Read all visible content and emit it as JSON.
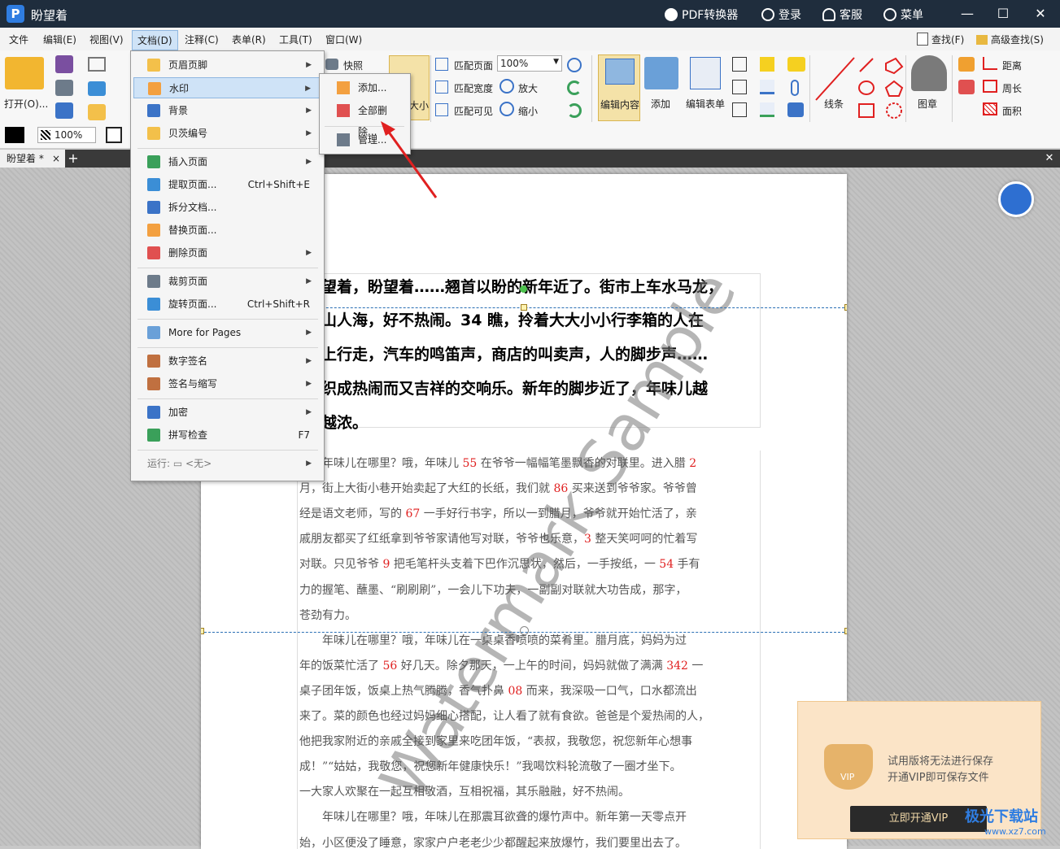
{
  "titlebar": {
    "logo_letter": "P",
    "app_name": "盼望着",
    "pdf_converter": "PDF转换器",
    "login": "登录",
    "service": "客服",
    "menu": "菜单",
    "minimize": "—",
    "maximize": "☐",
    "close": "✕"
  },
  "menubar": {
    "items": [
      "文件",
      "编辑(E)",
      "视图(V)",
      "文档(D)",
      "注释(C)",
      "表单(R)",
      "工具(T)",
      "窗口(W)"
    ],
    "find": "查找(F)",
    "advanced_find": "高级查找(S)"
  },
  "ribbon": {
    "open": "打开(O)...",
    "snapshot": "快照",
    "size_partial": "大小",
    "fit_page": "匹配页面",
    "fit_width": "匹配宽度",
    "fit_visible": "匹配可见",
    "zoom_value": "100%",
    "zoom_in": "放大",
    "zoom_out": "缩小",
    "edit_content": "编辑内容",
    "add": "添加",
    "edit_form": "编辑表单",
    "lines": "线条",
    "stamp": "图章",
    "distance": "距离",
    "perimeter": "周长",
    "area": "面积",
    "opacity_value": "100%"
  },
  "tabs": {
    "doc_tab": "盼望着 *",
    "close_tab": "×",
    "add_tab": "+",
    "close_all": "✕"
  },
  "doc_menu": {
    "items": [
      {
        "label": "页眉页脚",
        "shortcut": "",
        "arrow": "▶"
      },
      {
        "label": "水印",
        "shortcut": "",
        "arrow": "▶"
      },
      {
        "label": "背景",
        "shortcut": "",
        "arrow": "▶"
      },
      {
        "label": "贝茨编号",
        "shortcut": "",
        "arrow": "▶"
      },
      {
        "label": "插入页面",
        "shortcut": "",
        "arrow": "▶"
      },
      {
        "label": "提取页面...",
        "shortcut": "Ctrl+Shift+E",
        "arrow": ""
      },
      {
        "label": "拆分文档...",
        "shortcut": "",
        "arrow": ""
      },
      {
        "label": "替换页面...",
        "shortcut": "",
        "arrow": ""
      },
      {
        "label": "删除页面",
        "shortcut": "",
        "arrow": "▶"
      },
      {
        "label": "裁剪页面",
        "shortcut": "",
        "arrow": "▶"
      },
      {
        "label": "旋转页面...",
        "shortcut": "Ctrl+Shift+R",
        "arrow": ""
      },
      {
        "label": "More for Pages",
        "shortcut": "",
        "arrow": "▶"
      },
      {
        "label": "数字签名",
        "shortcut": "",
        "arrow": "▶"
      },
      {
        "label": "签名与缩写",
        "shortcut": "",
        "arrow": "▶"
      },
      {
        "label": "加密",
        "shortcut": "",
        "arrow": "▶"
      },
      {
        "label": "拼写检查",
        "shortcut": "F7",
        "arrow": ""
      },
      {
        "label": "运行: ▭ <无>",
        "shortcut": "",
        "arrow": "▶"
      }
    ]
  },
  "watermark_submenu": {
    "add": "添加...",
    "delete_all": "全部删除...",
    "manage": "管理..."
  },
  "document": {
    "heading_lines": [
      "望着，盼望着……翘首以盼的新年近了。街市上车水马龙，",
      "山人海，好不热闹。34 瞧，拎着大大小小行李箱的人在",
      "上行走，汽车的鸣笛声，商店的叫卖声，人的脚步声……",
      "织成热闹而又吉祥的交响乐。新年的脚步近了，年味儿越",
      "越浓。"
    ],
    "body_lines": [
      [
        {
          "t": "　　年味儿在哪里？哦，年味儿 "
        },
        {
          "t": "55",
          "r": true
        },
        {
          "t": " 在爷爷一幅幅笔墨飘香的对联里。进入腊 "
        },
        {
          "t": "2",
          "r": true
        }
      ],
      [
        {
          "t": "月，街上大街小巷开始卖起了大红的长纸，我们就 "
        },
        {
          "t": "86",
          "r": true
        },
        {
          "t": " 买来送到爷爷家。爷爷曾"
        }
      ],
      [
        {
          "t": "经是语文老师，写的 "
        },
        {
          "t": "67",
          "r": true
        },
        {
          "t": " 一手好行书字，所以一到腊月，爷爷就开始忙活了，亲"
        }
      ],
      [
        {
          "t": "戚朋友都买了红纸拿到爷爷家请他写对联，爷爷也乐意，"
        },
        {
          "t": "3",
          "r": true
        },
        {
          "t": " 整天笑呵呵的忙着写"
        }
      ],
      [
        {
          "t": "对联。只见爷爷 "
        },
        {
          "t": "9",
          "r": true
        },
        {
          "t": " 把毛笔杆头支着下巴作沉思状，然后，一手按纸，一 "
        },
        {
          "t": "54",
          "r": true
        },
        {
          "t": " 手有"
        }
      ],
      [
        {
          "t": "力的握笔、蘸墨、“刷刷刷”，一会儿下功夫，一副副对联就大功告成，那字，"
        }
      ],
      [
        {
          "t": "苍劲有力。"
        }
      ],
      [
        {
          "t": "　　年味儿在哪里？哦，年味儿在一桌桌香喷喷的菜肴里。腊月底，妈妈为过"
        }
      ],
      [
        {
          "t": "年的饭菜忙活了 "
        },
        {
          "t": "56",
          "r": true
        },
        {
          "t": " 好几天。除夕那天，一上午的时间，妈妈就做了满满 "
        },
        {
          "t": "342",
          "r": true
        },
        {
          "t": " 一"
        }
      ],
      [
        {
          "t": "桌子团年饭，饭桌上热气腾腾，香气扑鼻 "
        },
        {
          "t": "08",
          "r": true
        },
        {
          "t": " 而来，我深吸一口气，口水都流出"
        }
      ],
      [
        {
          "t": "来了。菜的颜色也经过妈妈细心搭配，让人看了就有食欲。爸爸是个爱热闹的人，"
        }
      ],
      [
        {
          "t": "他把我家附近的亲戚全接到家里来吃团年饭，“表叔，我敬您，祝您新年心想事"
        }
      ],
      [
        {
          "t": "成！”“姑姑，我敬您，祝您新年健康快乐！”我喝饮料轮流敬了一圈才坐下。"
        }
      ],
      [
        {
          "t": "一大家人欢聚在一起互相敬酒，互相祝福，其乐融融，好不热闹。"
        }
      ],
      [
        {
          "t": "　　年味儿在哪里？哦，年味儿在那震耳欲聋的爆竹声中。新年第一天零点开"
        }
      ],
      [
        {
          "t": "始，小区便没了睡意，家家户户老老少少都醒起来放爆竹，我们要里出去了。"
        }
      ]
    ],
    "watermark_text": "Watermark Sample"
  },
  "vip_popup": {
    "line1": "试用版将无法进行保存",
    "line2": "开通VIP即可保存文件",
    "button": "立即开通VIP",
    "badge": "VIP"
  },
  "site_watermark": {
    "name": "极光下载站",
    "url": "www.xz7.com"
  },
  "colors": {
    "titlebar": "#1f2d3d",
    "highlight": "#cfe3f7",
    "red_numbers": "#e02020",
    "arrow": "#e02020"
  }
}
